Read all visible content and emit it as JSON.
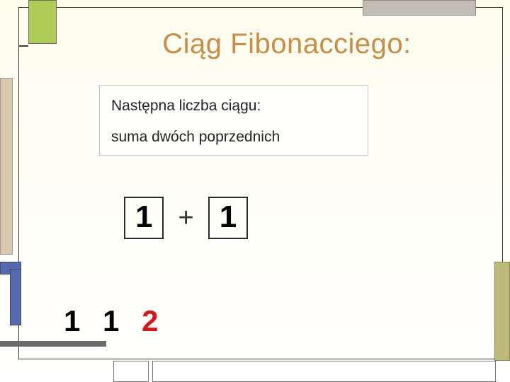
{
  "title": "Ciąg  Fibonacciego:",
  "textbox": {
    "line1": "Następna liczba ciągu:",
    "line2": "suma dwóch poprzednich"
  },
  "add": {
    "a": "1",
    "op": "+",
    "b": "1"
  },
  "sequence": {
    "n1": "1",
    "n2": "1",
    "result": "2"
  },
  "colors": {
    "title": "#c78e4a",
    "result": "#d11919",
    "green_block": "#aecb56",
    "blue_block": "#5469b0",
    "tan_block": "#d9c8ad",
    "olive_block": "#bdb97b",
    "grey_block": "#c2beb3"
  }
}
